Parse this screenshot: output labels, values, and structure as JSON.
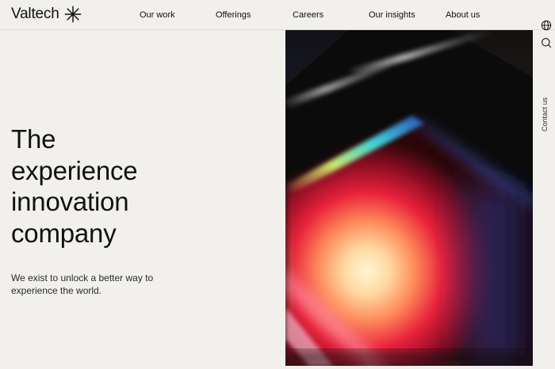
{
  "header": {
    "logo_text": "Valtech",
    "nav": [
      {
        "label": "Our work"
      },
      {
        "label": "Offerings"
      },
      {
        "label": "Careers"
      },
      {
        "label": "Our insights"
      },
      {
        "label": "About us"
      }
    ]
  },
  "rail": {
    "icons": [
      "globe-icon",
      "search-icon"
    ],
    "contact_label": "Contact us"
  },
  "hero": {
    "title_lines": [
      "The",
      "experience",
      "innovation",
      "company"
    ],
    "subtitle_lines": [
      "We exist to unlock a better way to",
      "experience the world."
    ]
  },
  "colors": {
    "background": "#f1f0ed",
    "text": "#111111",
    "image_dark": "#0b0a0a"
  }
}
